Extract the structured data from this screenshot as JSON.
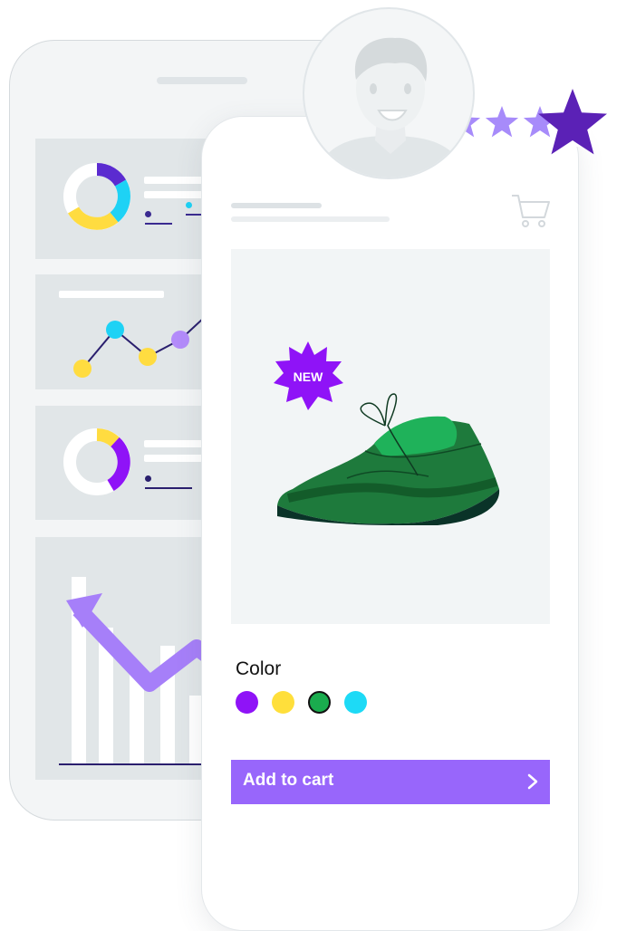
{
  "product": {
    "badge": "NEW",
    "color_label": "Color",
    "add_to_cart_label": "Add to cart",
    "colors": [
      "#8f13f7",
      "#ffdf3b",
      "#1aac4e",
      "#1ddaf6"
    ],
    "selected_color_index": 2
  },
  "rating": {
    "stars": 5,
    "star_color": "#a78bfa",
    "highlight_star_color": "#5b21b6"
  },
  "theme": {
    "accent": "#9866fb",
    "badge_color": "#8f13f7",
    "shoe_color": "#1e7a3c"
  },
  "icons": {
    "cart": "cart-icon",
    "chevron": "chevron-right-icon",
    "avatar": "user-avatar-icon",
    "star": "star-icon"
  }
}
